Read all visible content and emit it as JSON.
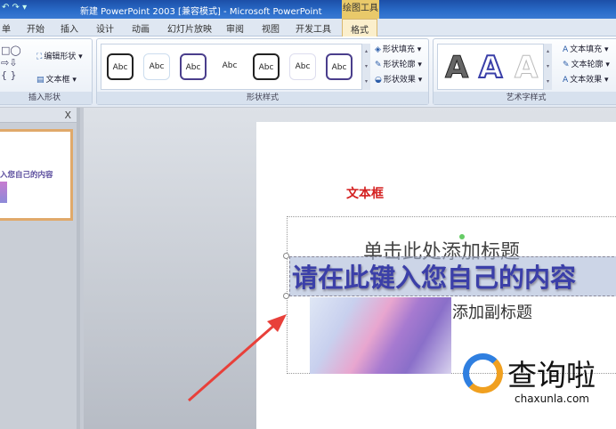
{
  "window": {
    "title": "新建 PowerPoint 2003 [兼容模式] - Microsoft PowerPoint",
    "context_tab_group": "绘图工具"
  },
  "tabs": [
    {
      "label": "单"
    },
    {
      "label": "开始"
    },
    {
      "label": "插入"
    },
    {
      "label": "设计"
    },
    {
      "label": "动画"
    },
    {
      "label": "幻灯片放映"
    },
    {
      "label": "审阅"
    },
    {
      "label": "视图"
    },
    {
      "label": "开发工具"
    },
    {
      "label": "格式",
      "active": true
    }
  ],
  "ribbon": {
    "insert_shapes": {
      "label": "插入形状",
      "edit_shape": "编辑形状 ▾",
      "text_box": "文本框 ▾"
    },
    "shape_styles": {
      "label": "形状样式",
      "gallery": [
        "Abc",
        "Abc",
        "Abc",
        "Abc",
        "Abc",
        "Abc",
        "Abc"
      ],
      "fill": "形状填充 ▾",
      "outline": "形状轮廓 ▾",
      "effects": "形状效果 ▾"
    },
    "wordart_styles": {
      "label": "艺术字样式",
      "gallery": [
        "A",
        "A",
        "A"
      ],
      "text_fill": "文本填充 ▾",
      "text_outline": "文本轮廓 ▾",
      "text_effects": "文本效果 ▾"
    }
  },
  "left_panel": {
    "close": "X",
    "thumbnail_text": "入您自己的内容"
  },
  "slide": {
    "textbox_label": "文本框",
    "title_placeholder": "单击此处添加标题",
    "wordart_text": "请在此键入您自己的内容",
    "subtitle_placeholder": "添加副标题"
  },
  "watermark": {
    "brand": "查询啦",
    "domain": "chaxunla.com"
  },
  "colors": {
    "accent_tab": "#fbefcc",
    "wordart_blue": "#3b3fa8",
    "textbox_red": "#d42020",
    "arrow": "#e8403a"
  }
}
